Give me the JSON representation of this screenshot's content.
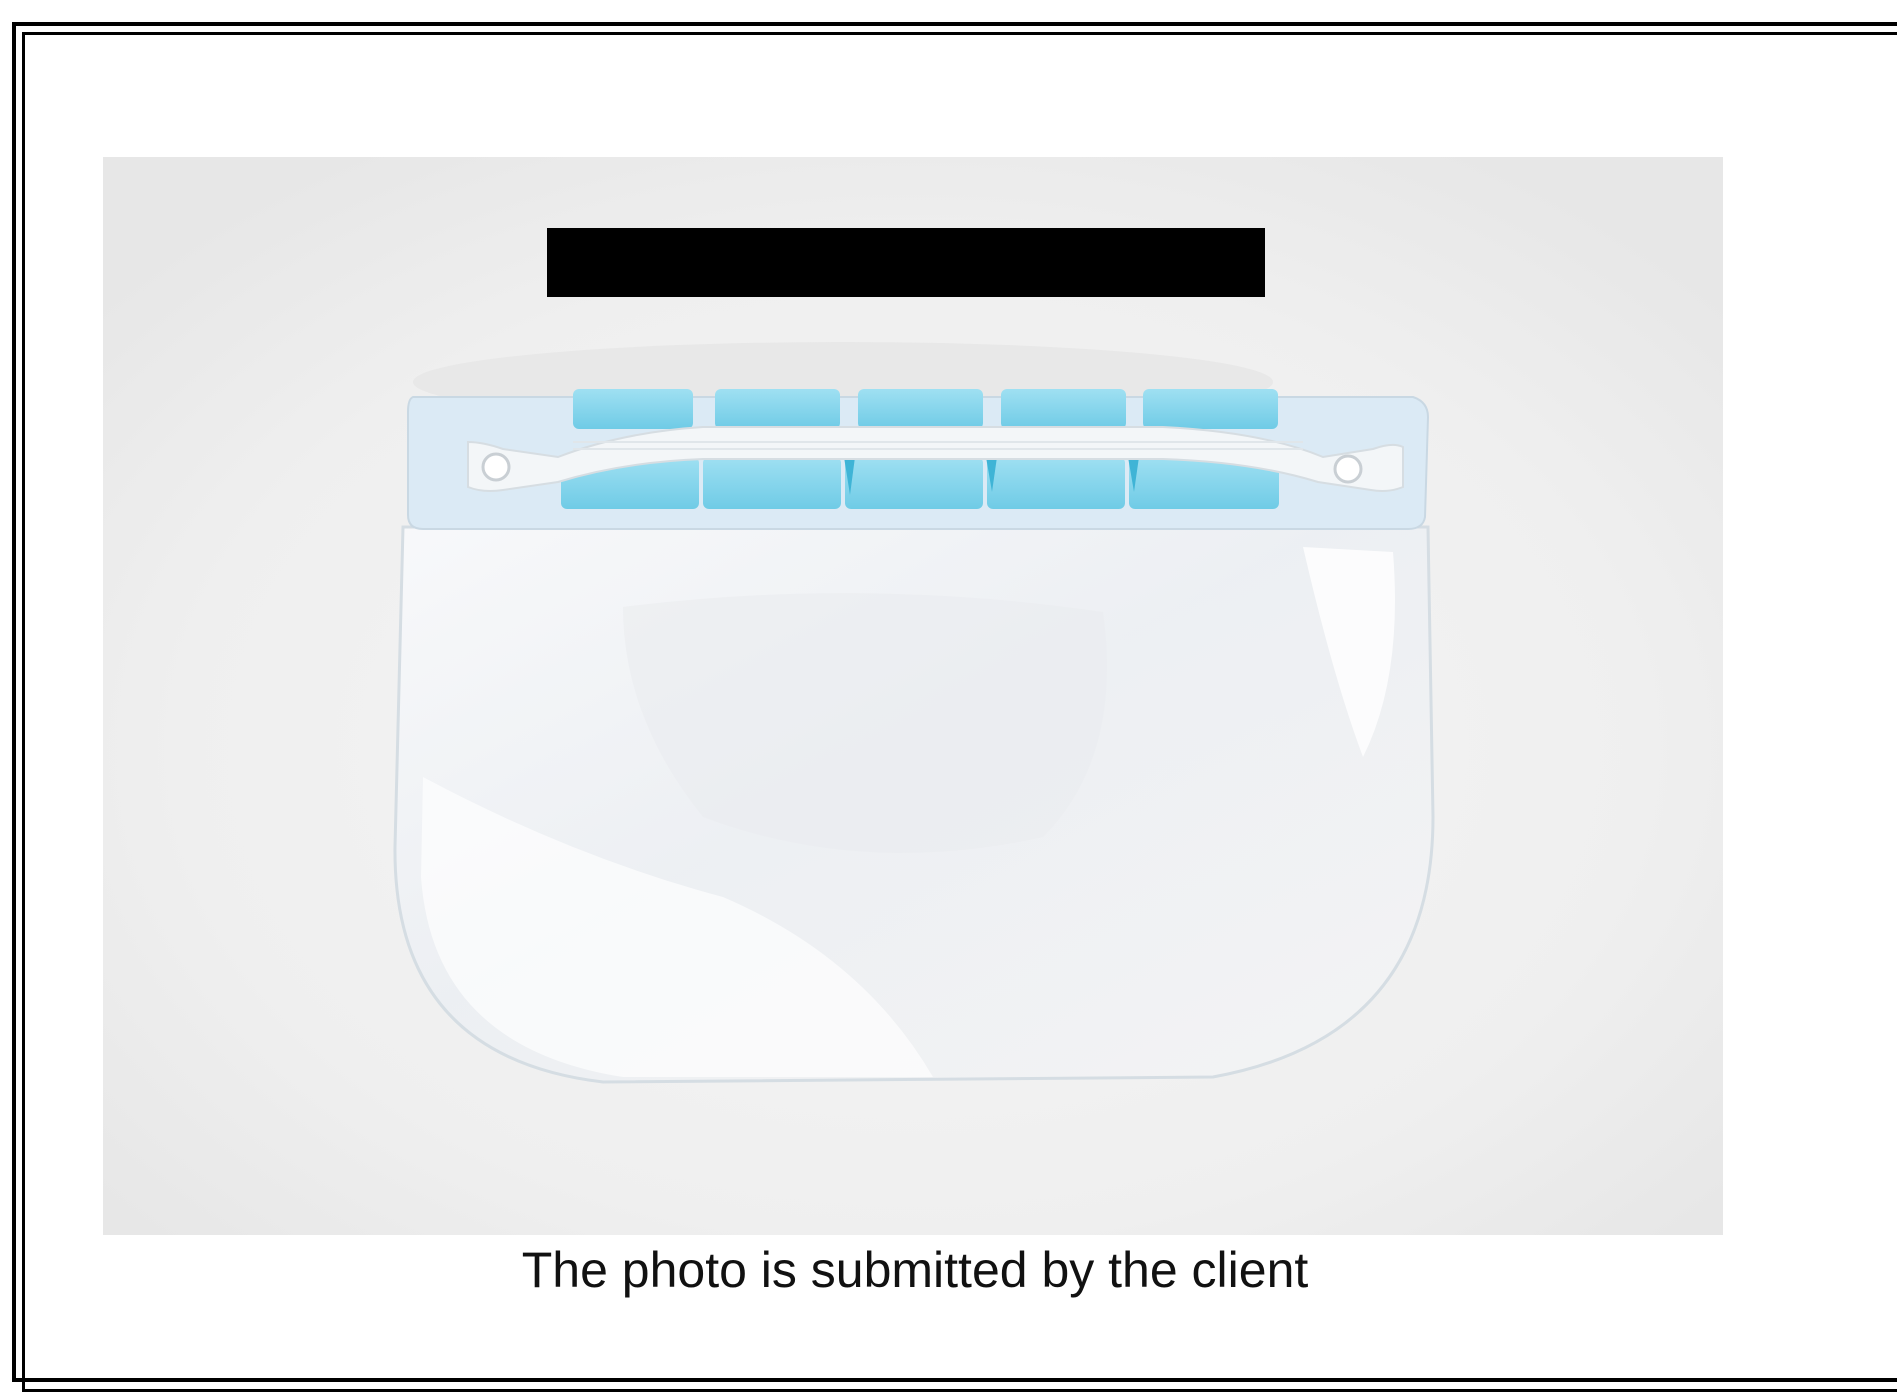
{
  "photo": {
    "subject_icon": "face-shield-icon",
    "colors": {
      "background": "#efefef",
      "foam": "#7fd3ea",
      "visor_edge": "#d7e2ea",
      "band": "#dfeef8",
      "redaction": "#000000"
    }
  },
  "caption": {
    "text": "The photo is submitted by the client"
  }
}
